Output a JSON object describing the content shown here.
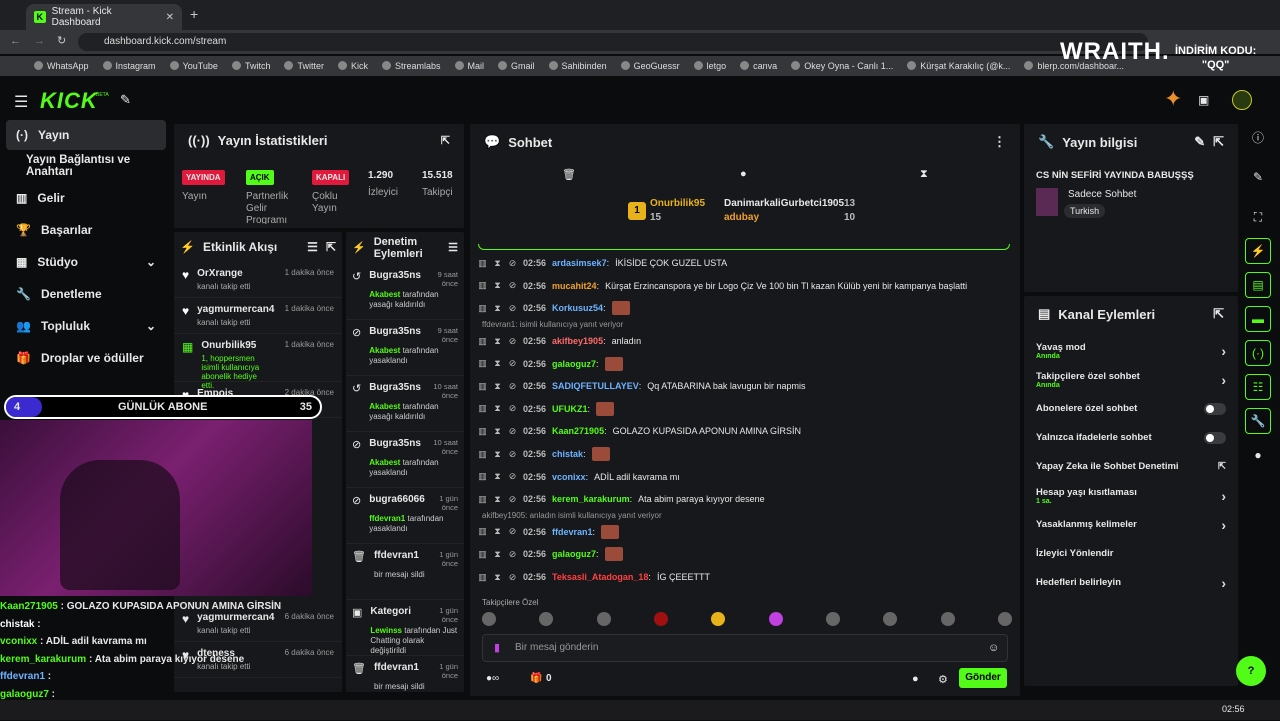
{
  "browser": {
    "tab_title": "Stream - Kick Dashboard",
    "url": "dashboard.kick.com/stream",
    "bookmarks": [
      "WhatsApp",
      "Instagram",
      "YouTube",
      "Twitch",
      "Twitter",
      "Kick",
      "Streamlabs",
      "Mail",
      "Gmail",
      "Sahibinden",
      "GeoGuessr",
      "letgo",
      "canva",
      "Okey Oyna - Canlı 1...",
      "Kürşat Karakılıç (@k...",
      "blerp.com/dashboar..."
    ],
    "other_bookmarks": "ler İşaretleri"
  },
  "sponsor": {
    "brand": "WRAITH.",
    "code_label": "İNDİRİM KODU:",
    "code": "\"QQ\""
  },
  "app": {
    "logo": "KICK",
    "beta": "BETA"
  },
  "sidebar": {
    "items": [
      {
        "label": "Yayın"
      },
      {
        "label": "Yayın Bağlantısı ve Anahtarı"
      },
      {
        "label": "Gelir"
      },
      {
        "label": "Başarılar"
      },
      {
        "label": "Stüdyo"
      },
      {
        "label": "Denetleme"
      },
      {
        "label": "Topluluk"
      },
      {
        "label": "Droplar ve ödüller"
      }
    ]
  },
  "stats": {
    "title": "Yayın İstatistikleri",
    "live_badge": "YAYINDA",
    "live_label": "Yayın",
    "partner_badge": "AÇIK",
    "partner_label": "Partnerlik Gelir Programı",
    "multi_badge": "KAPALI",
    "multi_label": "Çoklu Yayın",
    "viewers": "1.290",
    "viewers_label": "İzleyici",
    "followers": "15.518",
    "followers_label": "Takipçi"
  },
  "activity": {
    "title": "Etkinlik Akışı",
    "items": [
      {
        "name": "OrXrange",
        "sub": "kanalı takip etti",
        "time": "1 dakika önce"
      },
      {
        "name": "yagmurmercan4",
        "sub": "kanalı takip etti",
        "time": "1 dakika önce"
      },
      {
        "name": "Onurbilik95",
        "sub": "1, hoppersmen isimli kullanıcıya abonelik hediye etti.",
        "time": "1 dakika önce"
      },
      {
        "name": "Empois",
        "sub": "kanalı takip etti",
        "time": "2 dakika önce"
      }
    ],
    "bottom_items": [
      {
        "name": "yagmurmercan4",
        "sub": "kanalı takip etti",
        "time": "6 dakika önce"
      },
      {
        "name": "dteness",
        "sub": "kanalı takip etti",
        "time": "6 dakika önce"
      }
    ],
    "hidden_sub": "kanalı takip etti"
  },
  "moderation": {
    "title": "Denetim Eylemleri",
    "items": [
      {
        "name": "Bugra35ns",
        "time": "9 saat önce",
        "by": "Akabest",
        "text": "tarafından yasağı kaldırıldı"
      },
      {
        "name": "Bugra35ns",
        "time": "9 saat önce",
        "by": "Akabest",
        "text": "tarafından yasaklandı"
      },
      {
        "name": "Bugra35ns",
        "time": "10 saat önce",
        "by": "Akabest",
        "text": "tarafından yasağı kaldırıldı"
      },
      {
        "name": "Bugra35ns",
        "time": "10 saat önce",
        "by": "Akabest",
        "text": "tarafından yasaklandı"
      },
      {
        "name": "bugra66066",
        "time": "1 gün önce",
        "by": "ffdevran1",
        "text": "tarafından yasaklandı"
      },
      {
        "name": "ffdevran1",
        "time": "1 gün önce",
        "by": "",
        "text": "bir mesajı sildi"
      },
      {
        "name": "Kategori",
        "time": "1 gün önce",
        "by": "Lewinss",
        "text": "tarafından Just Chatting olarak değiştirildi"
      },
      {
        "name": "ffdevran1",
        "time": "1 gün önce",
        "by": "",
        "text": "bir mesajı sildi"
      }
    ]
  },
  "chat": {
    "title": "Sohbet",
    "leader1": {
      "name": "Onurbilik95",
      "count": "15",
      "rank": "1"
    },
    "leader2": {
      "name": "DanimarkaliGurbetci1905",
      "count": "13"
    },
    "leader3": {
      "name": "adubay",
      "count": "10"
    },
    "messages": [
      {
        "time": "02:56",
        "user": "ardasimsek7",
        "color": "#6db3ff",
        "text": "İKİSİDE ÇOK GUZEL USTA"
      },
      {
        "time": "02:56",
        "user": "mucahit24",
        "color": "#f0a030",
        "text": "Kürşat Erzincanspora ye bir Logo Çiz Ve 100 bin Tl kazan Külüb yeni bir kampanya başlatti"
      },
      {
        "time": "02:56",
        "user": "Korkusuz54",
        "color": "#6db3ff",
        "text": ""
      },
      {
        "time": "02:56",
        "user": "akifbey1905",
        "color": "#ff6b6b",
        "text": "anladın",
        "reply": "ffdevran1: isimli kullanıcıya yanıt veriyor"
      },
      {
        "time": "02:56",
        "user": "galaoguz7",
        "color": "#53fc18",
        "text": ""
      },
      {
        "time": "02:56",
        "user": "SADIQFETULLAYEV",
        "color": "#6db3ff",
        "text": "Qq ATABARINA bak lavugun bir napmis"
      },
      {
        "time": "02:56",
        "user": "UFUKZ1",
        "color": "#53fc18",
        "text": ""
      },
      {
        "time": "02:56",
        "user": "Kaan271905",
        "color": "#53fc18",
        "text": "GOLAZO KUPASIDA APONUN AMINA GİRSİN"
      },
      {
        "time": "02:56",
        "user": "chistak",
        "color": "#6db3ff",
        "text": ""
      },
      {
        "time": "02:56",
        "user": "vconixx",
        "color": "#6db3ff",
        "text": "ADİL adil kavrama mı"
      },
      {
        "time": "02:56",
        "user": "kerem_karakurum",
        "color": "#53fc18",
        "text": "Ata abim paraya kıyıyor desene"
      },
      {
        "time": "02:56",
        "user": "ffdevran1",
        "color": "#6db3ff",
        "text": "",
        "reply": "akifbey1905: anladın isimli kullanıcıya yanıt veriyor"
      },
      {
        "time": "02:56",
        "user": "galaoguz7",
        "color": "#53fc18",
        "text": ""
      },
      {
        "time": "02:56",
        "user": "Teksasli_Atadogan_18",
        "color": "#ff4040",
        "text": "İG ÇEEETTT"
      }
    ],
    "followers_only": "Takipçilere Özel",
    "placeholder": "Bir mesaj gönderin",
    "gift_count": "0",
    "send": "Gönder"
  },
  "info": {
    "title": "Yayın bilgisi",
    "stream_title": "CS NİN SEFİRİ YAYINDA BABUŞŞŞ",
    "category": "Sadece Sohbet",
    "language": "Turkish"
  },
  "channel_actions": {
    "title": "Kanal Eylemleri",
    "items": [
      {
        "label": "Yavaş mod",
        "sub": "Anında",
        "type": "chev"
      },
      {
        "label": "Takipçilere özel sohbet",
        "sub": "Anında",
        "type": "chev"
      },
      {
        "label": "Abonelere özel sohbet",
        "sub": "",
        "type": "toggle"
      },
      {
        "label": "Yalnızca ifadelerle sohbet",
        "sub": "",
        "type": "toggle"
      },
      {
        "label": "Yapay Zeka ile Sohbet Denetimi",
        "sub": "",
        "type": "ext"
      },
      {
        "label": "Hesap yaşı kısıtlaması",
        "sub": "1 sa.",
        "type": "chev"
      },
      {
        "label": "Yasaklanmış kelimeler",
        "sub": "",
        "type": "chev"
      },
      {
        "label": "İzleyici Yönlendir",
        "sub": "",
        "type": "none"
      },
      {
        "label": "Hedefleri belirleyin",
        "sub": "",
        "type": "chev"
      }
    ]
  },
  "overlay": {
    "sub_count": "4",
    "sub_label": "GÜNLÜK ABONE",
    "sub_goal": "35",
    "chat": [
      {
        "user": "Kaan271905",
        "text": " : GOLAZO KUPASIDA APONUN AMINA GİRSİN",
        "color": "#53fc18"
      },
      {
        "user": "chistak",
        "text": " :",
        "color": "#fff"
      },
      {
        "user": "vconixx",
        "text": " : ADİL adil kavrama mı",
        "color": "#53fc18"
      },
      {
        "user": "kerem_karakurum",
        "text": " : Ata abim paraya kıyıyor desene",
        "color": "#53fc18"
      },
      {
        "user": "ffdevran1",
        "text": " :",
        "color": "#6db3ff"
      },
      {
        "user": "galaoguz7",
        "text": " :",
        "color": "#53fc18"
      },
      {
        "user": "Teksasli_Atadogan_18",
        "text": " : İG ÇEEETTT",
        "color": "#ff4040"
      }
    ]
  },
  "system": {
    "clock": "02:56"
  }
}
